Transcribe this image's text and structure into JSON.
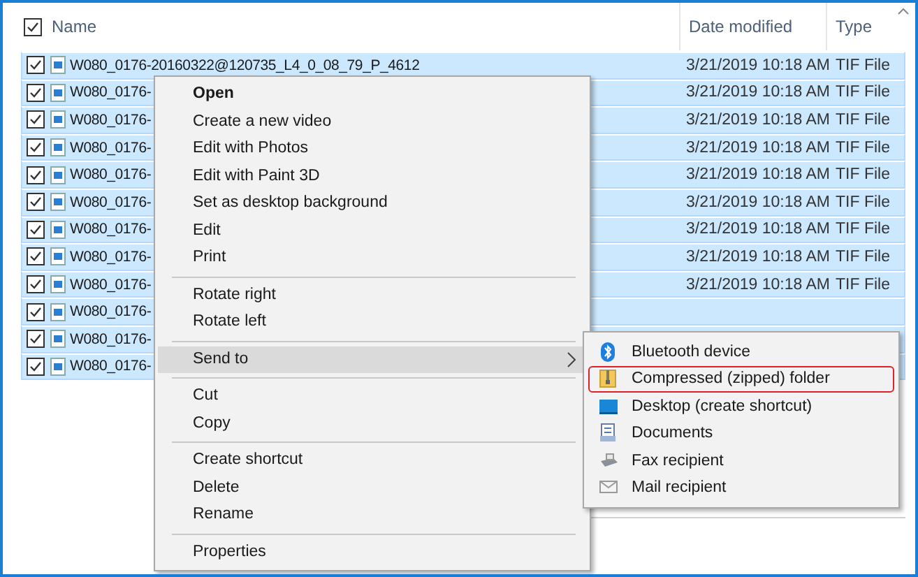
{
  "header": {
    "checked": true,
    "columns": [
      "Name",
      "Date modified",
      "Type"
    ]
  },
  "rows": [
    {
      "name": "W080_0176-20160322@120735_L4_0_08_79_P_4612",
      "date": "3/21/2019 10:18 AM",
      "type": "TIF File",
      "checked": true,
      "selected": true
    },
    {
      "name": "W080_0176-",
      "date": "3/21/2019 10:18 AM",
      "type": "TIF File",
      "checked": true,
      "selected": true
    },
    {
      "name": "W080_0176-",
      "date": "3/21/2019 10:18 AM",
      "type": "TIF File",
      "checked": true,
      "selected": true
    },
    {
      "name": "W080_0176-",
      "date": "3/21/2019 10:18 AM",
      "type": "TIF File",
      "checked": true,
      "selected": true
    },
    {
      "name": "W080_0176-",
      "date": "3/21/2019 10:18 AM",
      "type": "TIF File",
      "checked": true,
      "selected": true
    },
    {
      "name": "W080_0176-",
      "date": "3/21/2019 10:18 AM",
      "type": "TIF File",
      "checked": true,
      "selected": true
    },
    {
      "name": "W080_0176-",
      "date": "3/21/2019 10:18 AM",
      "type": "TIF File",
      "checked": true,
      "selected": true
    },
    {
      "name": "W080_0176-",
      "date": "3/21/2019 10:18 AM",
      "type": "TIF File",
      "checked": true,
      "selected": true
    },
    {
      "name": "W080_0176-",
      "date": "3/21/2019 10:18 AM",
      "type": "TIF File",
      "checked": true,
      "selected": true
    },
    {
      "name": "W080_0176-",
      "checked": true,
      "selected": true
    },
    {
      "name": "W080_0176-",
      "checked": true,
      "selected": true
    },
    {
      "name": "W080_0176-",
      "checked": true,
      "selected": true
    }
  ],
  "context_menu": [
    {
      "kind": "item",
      "label": "Open",
      "default": true,
      "selected": false
    },
    {
      "kind": "item",
      "label": "Create a new video",
      "default": false,
      "selected": false
    },
    {
      "kind": "item",
      "label": "Edit with Photos",
      "default": false,
      "selected": false
    },
    {
      "kind": "item",
      "label": "Edit with Paint 3D",
      "default": false,
      "selected": false
    },
    {
      "kind": "item",
      "label": "Set as desktop background",
      "default": false,
      "selected": false
    },
    {
      "kind": "item",
      "label": "Edit",
      "default": false,
      "selected": false
    },
    {
      "kind": "item",
      "label": "Print",
      "default": false,
      "selected": false
    },
    {
      "kind": "separator"
    },
    {
      "kind": "item",
      "label": "Rotate right",
      "default": false,
      "selected": false
    },
    {
      "kind": "item",
      "label": "Rotate left",
      "default": false,
      "selected": false
    },
    {
      "kind": "separator"
    },
    {
      "kind": "submenu",
      "label": "Send to",
      "default": false,
      "selected": true
    },
    {
      "kind": "separator"
    },
    {
      "kind": "item",
      "label": "Cut",
      "default": false,
      "selected": false
    },
    {
      "kind": "item",
      "label": "Copy",
      "default": false,
      "selected": false
    },
    {
      "kind": "separator"
    },
    {
      "kind": "item",
      "label": "Create shortcut",
      "default": false,
      "selected": false
    },
    {
      "kind": "item",
      "label": "Delete",
      "default": false,
      "selected": false
    },
    {
      "kind": "item",
      "label": "Rename",
      "default": false,
      "selected": false
    },
    {
      "kind": "separator"
    },
    {
      "kind": "item",
      "label": "Properties",
      "default": false,
      "selected": false
    }
  ],
  "send_to_menu": [
    {
      "label": "Bluetooth device",
      "highlighted": false
    },
    {
      "label": "Compressed (zipped) folder",
      "highlighted": true
    },
    {
      "label": "Desktop (create shortcut)",
      "highlighted": false
    },
    {
      "label": "Documents",
      "highlighted": false
    },
    {
      "label": "Fax recipient",
      "highlighted": false
    },
    {
      "label": "Mail recipient",
      "highlighted": false
    }
  ]
}
